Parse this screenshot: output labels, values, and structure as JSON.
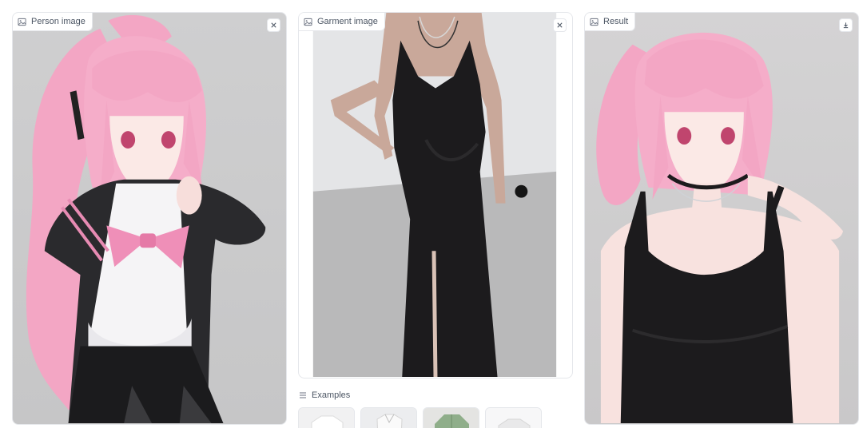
{
  "panels": {
    "person": {
      "label": "Person image",
      "icon": "image-icon",
      "action_icon": "close-icon"
    },
    "garment": {
      "label": "Garment image",
      "icon": "image-icon",
      "action_icon": "close-icon"
    },
    "result": {
      "label": "Result",
      "icon": "image-icon",
      "action_icon": "download-icon"
    }
  },
  "examples": {
    "label": "Examples",
    "icon": "list-icon",
    "items": [
      "white-tshirt",
      "white-top",
      "green-jacket",
      "white-tshirt-2"
    ]
  },
  "colors": {
    "hair_pink": "#f3a6c4",
    "dress_black": "#1c1b1d",
    "bow_pink": "#ef8fb8",
    "border": "#e5e7eb"
  }
}
